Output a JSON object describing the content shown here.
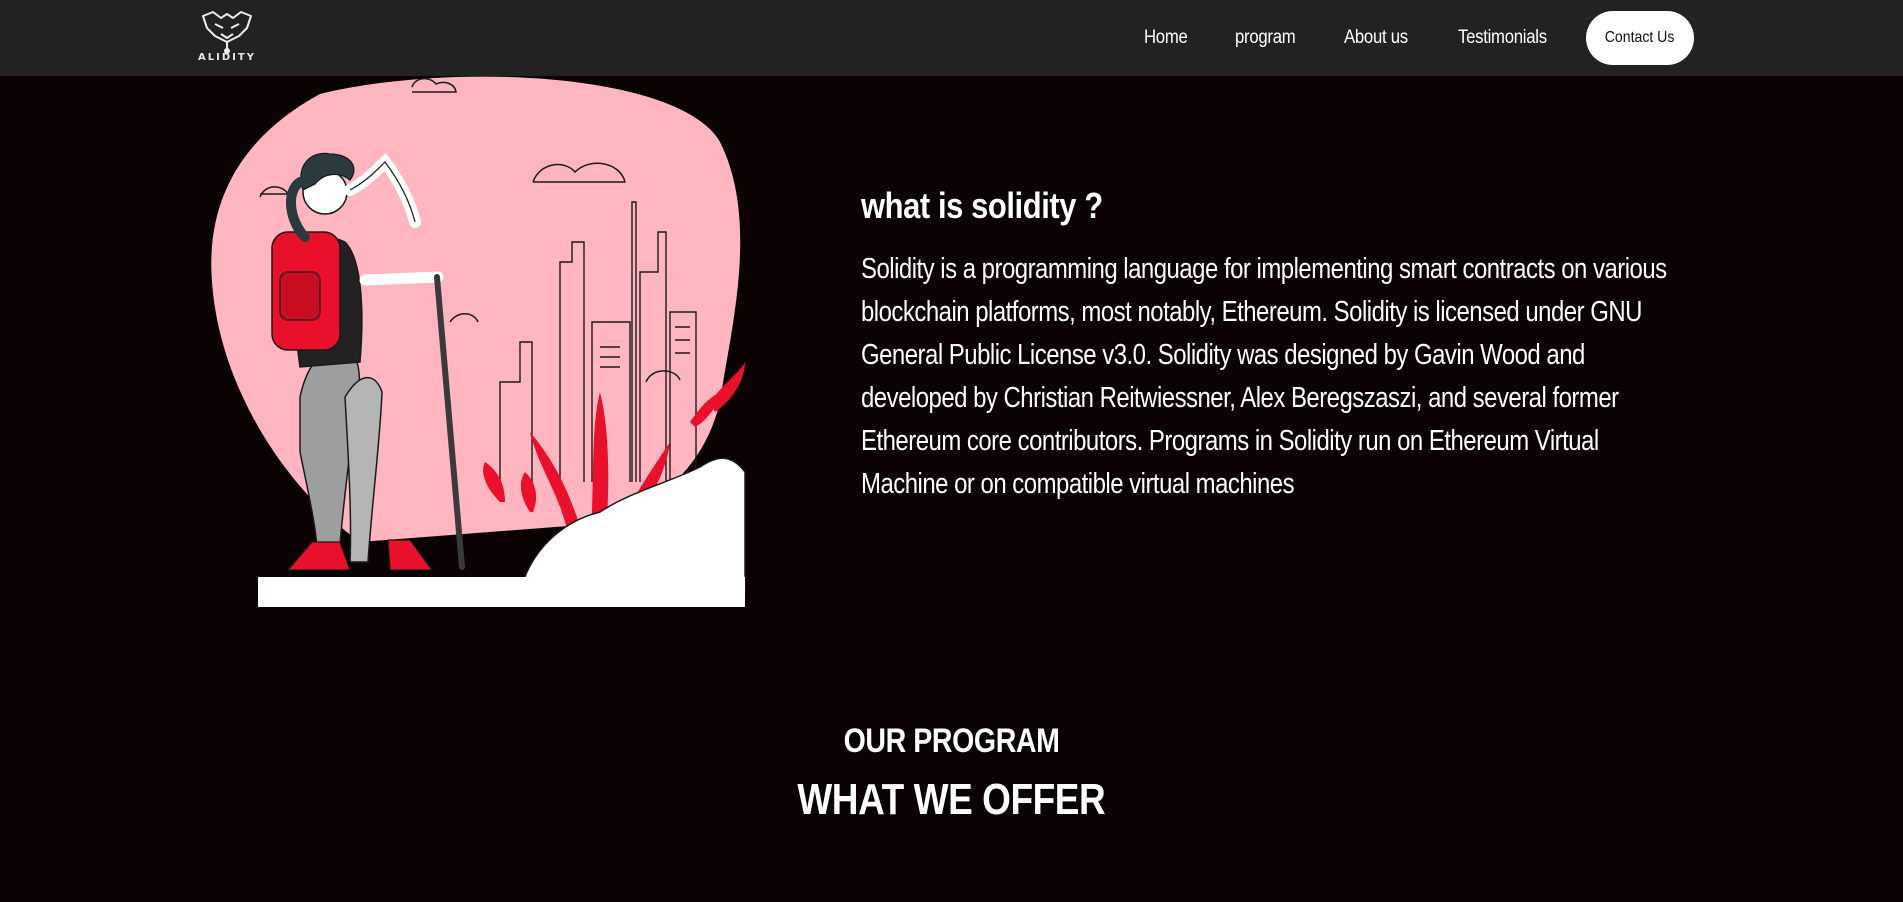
{
  "nav": {
    "logo_text": "ALIDITY",
    "links": [
      {
        "label": "Home"
      },
      {
        "label": "program"
      },
      {
        "label": "About us"
      },
      {
        "label": "Testimonials"
      }
    ],
    "contact_label": "Contact Us"
  },
  "about": {
    "title": "what is solidity ?",
    "body": "Solidity is a programming language for implementing smart contracts on various blockchain platforms, most notably, Ethereum. Solidity is licensed under GNU General Public License v3.0. Solidity was designed by Gavin Wood and developed by Christian Reitwiessner, Alex Beregszaszi, and several former Ethereum core contributors. Programs in Solidity run on Ethereum Virtual Machine or on compatible virtual machines"
  },
  "program": {
    "label": "OUR PROGRAM",
    "title": "WHAT WE OFFER"
  },
  "colors": {
    "nav_bg": "#222222",
    "page_bg": "#0b0204",
    "accent_red": "#e8102a",
    "blob_pink": "#ffb6c1"
  }
}
